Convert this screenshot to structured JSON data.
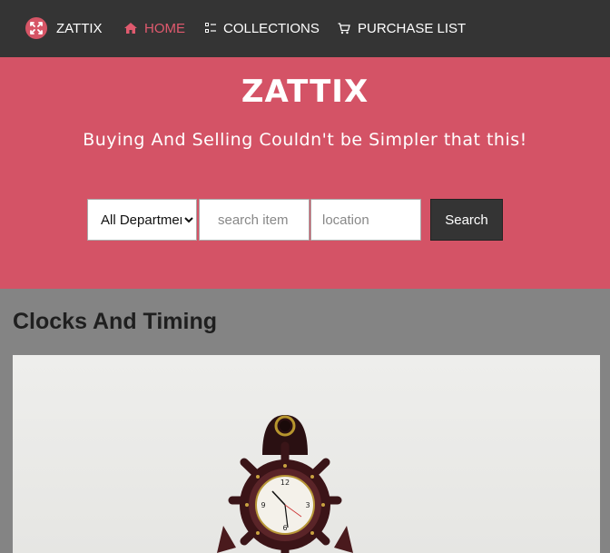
{
  "nav": {
    "brand": "ZATTIX",
    "links": [
      {
        "label": "HOME",
        "icon": "home-icon",
        "active": true
      },
      {
        "label": "COLLECTIONS",
        "icon": "list-icon",
        "active": false
      },
      {
        "label": "PURCHASE LIST",
        "icon": "cart-icon",
        "active": false
      }
    ]
  },
  "hero": {
    "title": "ZATTIX",
    "subtitle": "Buying And Selling Couldn't be Simpler that this!"
  },
  "search": {
    "department_selected": "All Departments",
    "item_placeholder": "search item",
    "location_placeholder": "location",
    "button_label": "Search"
  },
  "section": {
    "title": "Clocks And Timing"
  },
  "colors": {
    "navbar": "#343434",
    "accent": "#d45366",
    "active_link": "#e05a6e",
    "content_bg": "#848484"
  }
}
